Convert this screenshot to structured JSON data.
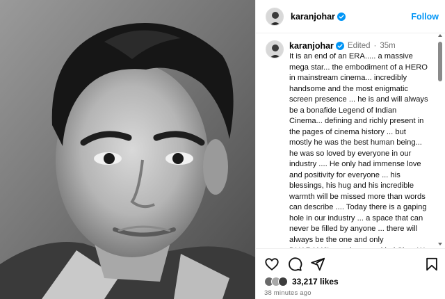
{
  "post": {
    "author": {
      "username": "karanjohar",
      "verified": true,
      "avatar_icon": "profile-avatar"
    },
    "header": {
      "follow_label": "Follow"
    },
    "caption": {
      "edited_label": "Edited",
      "separator": "·",
      "time": "35m",
      "text": "It is an end of an ERA..... a massive\nmega star... the embodiment of a HERO\nin mainstream cinema... incredibly\nhandsome and the most  enigmatic\nscreen presence ... he is and will always\nbe a bonafide Legend of Indian\nCinema... defining and richly present in\nthe pages of cinema history ... but\nmostly he was the best human being...\nhe was so loved by everyone in our\nindustry .... He only had immense love\nand positivity for everyone ... his\nblessings, his hug and his incredible\nwarmth will be missed more than words\ncan describe .... Today there is a gaping\nhole in our industry ... a space that can\nnever be filled by anyone ... there will\nalways be the  one and only\nDHARAMJI... we love you kind Sir.... We\nwill miss you so much.... The heavens"
    },
    "actions": {
      "icons": [
        "heart-icon",
        "comment-icon",
        "share-icon",
        "bookmark-icon"
      ]
    },
    "likes": {
      "count_label": "33,217 likes"
    },
    "timestamp": "38 minutes ago",
    "colors": {
      "accent": "#0095f6",
      "verified_badge": "#0095f6",
      "muted_text": "#737373",
      "divider": "#efefef"
    }
  }
}
